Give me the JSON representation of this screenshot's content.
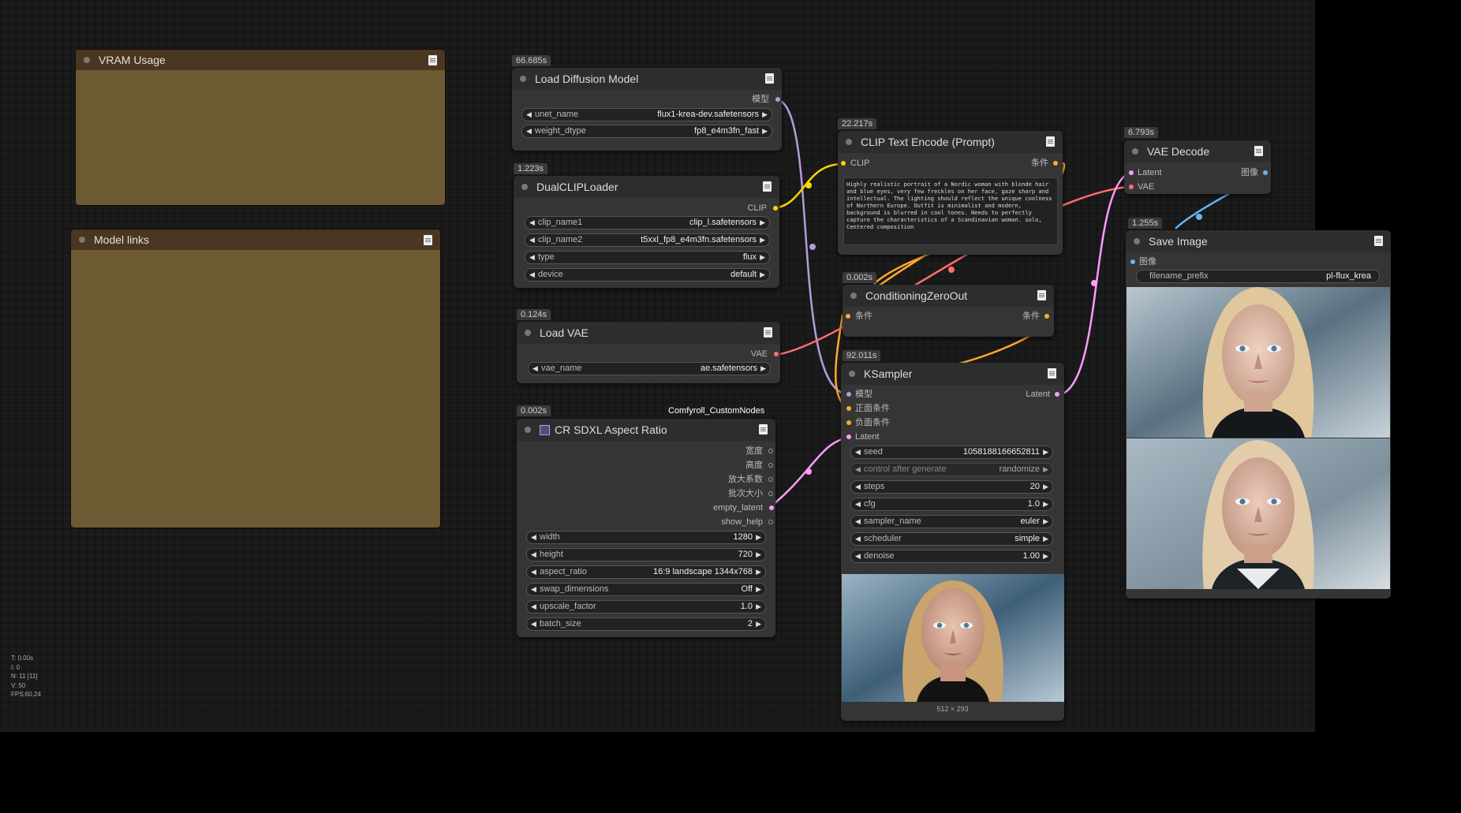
{
  "groups": {
    "vram": {
      "title": "VRAM Usage"
    },
    "links": {
      "title": "Model links"
    }
  },
  "nodes": {
    "load_diffusion": {
      "time": "66.685s",
      "title": "Load Diffusion Model",
      "output": "模型",
      "widgets": [
        {
          "name": "unet_name",
          "value": "flux1-krea-dev.safetensors"
        },
        {
          "name": "weight_dtype",
          "value": "fp8_e4m3fn_fast"
        }
      ]
    },
    "dualclip": {
      "time": "1.223s",
      "title": "DualCLIPLoader",
      "output": "CLIP",
      "widgets": [
        {
          "name": "clip_name1",
          "value": "clip_l.safetensors"
        },
        {
          "name": "clip_name2",
          "value": "t5xxl_fp8_e4m3fn.safetensors"
        },
        {
          "name": "type",
          "value": "flux"
        },
        {
          "name": "device",
          "value": "default"
        }
      ]
    },
    "load_vae": {
      "time": "0.124s",
      "title": "Load VAE",
      "output": "VAE",
      "widgets": [
        {
          "name": "vae_name",
          "value": "ae.safetensors"
        }
      ]
    },
    "cr_sdxl": {
      "time": "0.002s",
      "badge": "Comfyroll_CustomNodes",
      "title": "CR SDXL Aspect Ratio",
      "outputs": [
        "宽度",
        "高度",
        "放大系数",
        "批次大小",
        "empty_latent",
        "show_help"
      ],
      "widgets": [
        {
          "name": "width",
          "value": "1280"
        },
        {
          "name": "height",
          "value": "720"
        },
        {
          "name": "aspect_ratio",
          "value": "16:9 landscape 1344x768"
        },
        {
          "name": "swap_dimensions",
          "value": "Off"
        },
        {
          "name": "upscale_factor",
          "value": "1.0"
        },
        {
          "name": "batch_size",
          "value": "2"
        }
      ]
    },
    "clip_text": {
      "time": "22.217s",
      "title": "CLIP Text Encode (Prompt)",
      "input": "CLIP",
      "output": "条件",
      "prompt": "Highly realistic portrait of a Nordic woman with blonde hair and blue eyes, very few freckles on her face, gaze sharp and intellectual. The lighting should reflect the unique coolness of Northern Europe. Outfit is minimalist and modern, background is blurred in cool tones. Needs to perfectly capture the characteristics of a Scandinavian woman. solo, Centered composition"
    },
    "cond_zero": {
      "time": "0.002s",
      "title": "ConditioningZeroOut",
      "input": "条件",
      "output": "条件"
    },
    "ksampler": {
      "time": "92.011s",
      "title": "KSampler",
      "inputs": [
        "模型",
        "正面条件",
        "负面条件",
        "Latent"
      ],
      "output": "Latent",
      "widgets": [
        {
          "name": "seed",
          "value": "1058188166652811"
        },
        {
          "name": "control after generate",
          "value": "randomize"
        },
        {
          "name": "steps",
          "value": "20"
        },
        {
          "name": "cfg",
          "value": "1.0"
        },
        {
          "name": "sampler_name",
          "value": "euler"
        },
        {
          "name": "scheduler",
          "value": "simple"
        },
        {
          "name": "denoise",
          "value": "1.00"
        }
      ],
      "preview_size": "512 × 293"
    },
    "vae_decode": {
      "time": "6.793s",
      "title": "VAE Decode",
      "inputs": [
        "Latent",
        "VAE"
      ],
      "output": "图像"
    },
    "save_image": {
      "time": "1.255s",
      "title": "Save Image",
      "input": "图像",
      "widgets": [
        {
          "name": "filename_prefix",
          "value": "pl-flux_krea"
        }
      ]
    }
  },
  "stats": {
    "t": "T: 0.00s",
    "i": "I: 0",
    "n": "N: 11 [11]",
    "v": "V: 50",
    "fps": "FPS:60.24"
  },
  "colors": {
    "model": "#b39ddb",
    "clip": "#ffd500",
    "conditioning": "#ffa931",
    "latent": "#ff9cf9",
    "vae": "#ff6e6e",
    "image": "#64b5f6"
  }
}
